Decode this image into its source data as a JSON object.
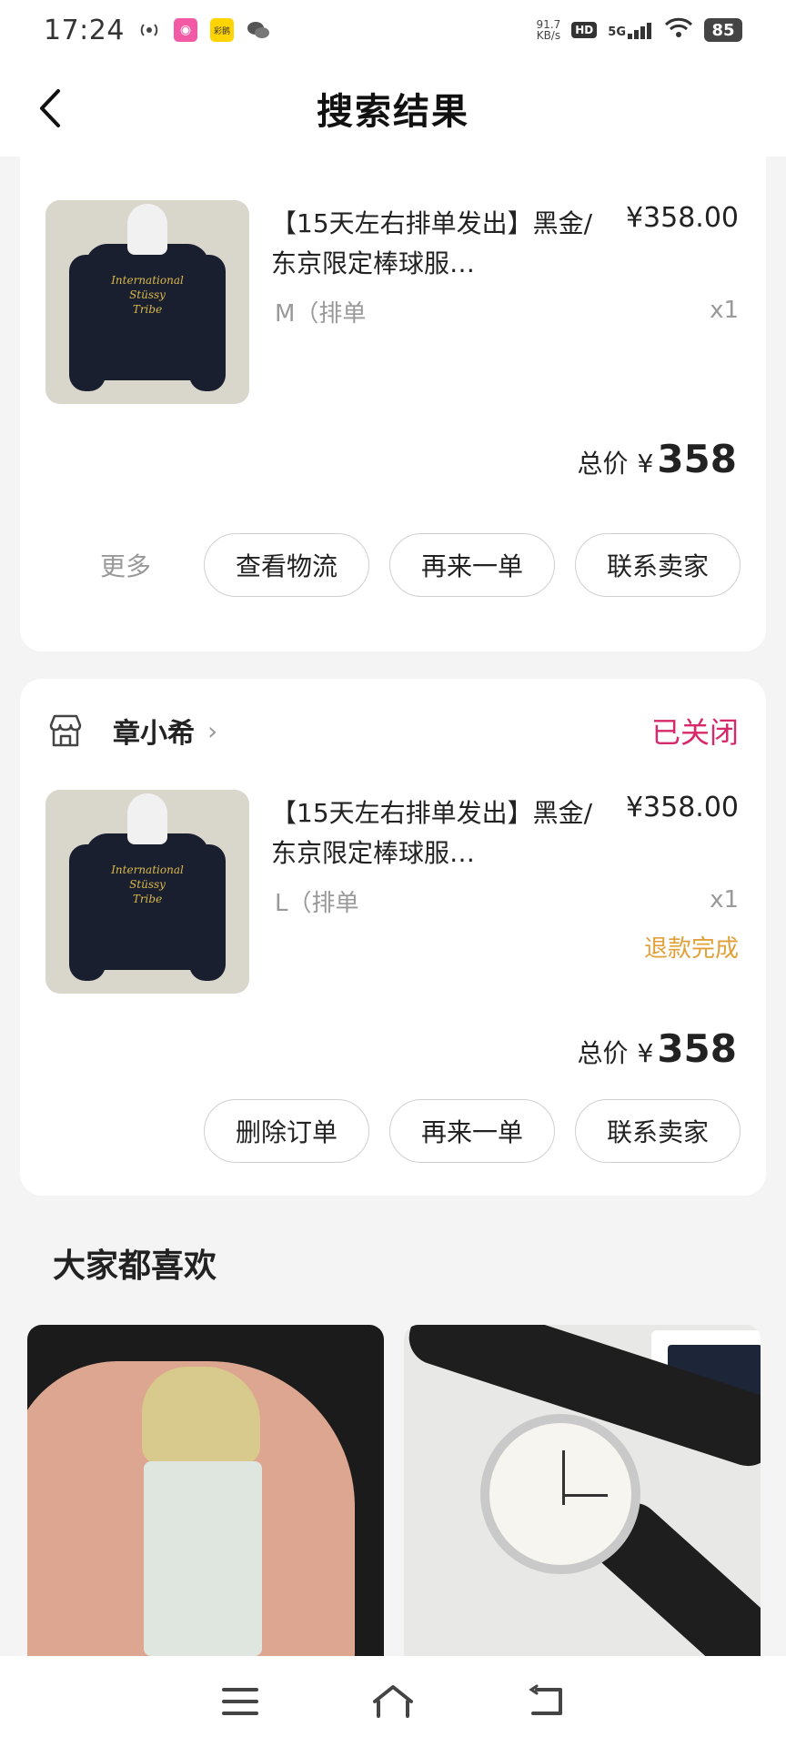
{
  "status_bar": {
    "time": "17:24",
    "net_speed_value": "91.7",
    "net_speed_unit": "KB/s",
    "hd_label": "HD",
    "signal_label": "5G",
    "battery": "85",
    "yellow_app_label": "彩鹅"
  },
  "header": {
    "title": "搜索结果"
  },
  "orders": [
    {
      "product_title": "【15天左右排单发出】黑金/东京限定棒球服…",
      "price": "¥358.00",
      "spec": "M（排单",
      "qty": "x1",
      "total_label": "总价",
      "total_currency": "¥",
      "total_amount": "358",
      "more_label": "更多",
      "actions": [
        "查看物流",
        "再来一单",
        "联系卖家"
      ]
    },
    {
      "shop_name": "章小希",
      "status": "已关闭",
      "product_title": "【15天左右排单发出】黑金/东京限定棒球服…",
      "price": "¥358.00",
      "spec": "L（排单",
      "qty": "x1",
      "refund_status": "退款完成",
      "total_label": "总价",
      "total_currency": "¥",
      "total_amount": "358",
      "actions": [
        "删除订单",
        "再来一单",
        "联系卖家"
      ]
    }
  ],
  "recommendations": {
    "title": "大家都喜欢"
  },
  "icons": {
    "back": "chevron-left-icon",
    "shop": "shop-icon",
    "menu": "menu-icon",
    "home": "home-icon",
    "back_nav": "return-icon"
  },
  "colors": {
    "closed_status": "#d6286b",
    "refund_status": "#e0a13a",
    "page_bg": "#f4f4f4"
  }
}
